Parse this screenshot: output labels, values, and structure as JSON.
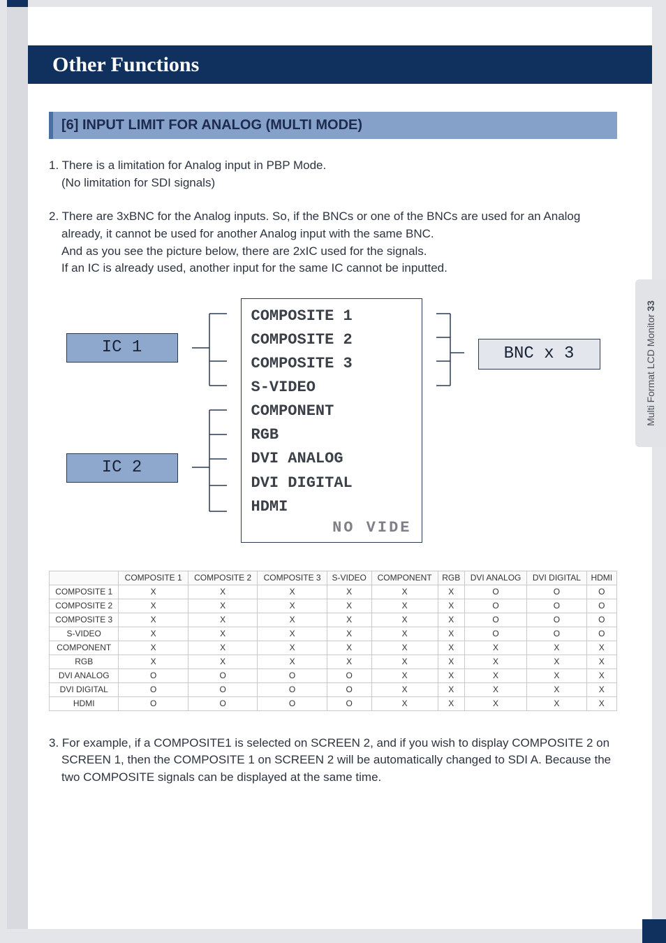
{
  "header": {
    "title": "Other Functions"
  },
  "section": {
    "title": "[6] INPUT LIMIT FOR ANALOG (MULTI MODE)"
  },
  "para1_lead": "1. There is a limitation for Analog input in PBP Mode.",
  "para1_sub": "(No limitation for SDI signals)",
  "para2_lead": "2. There are 3xBNC for the Analog inputs. So, if the BNCs or one of the BNCs are used for an Analog",
  "para2_l2": "already, it cannot be used for another Analog input with the same BNC.",
  "para2_l3": "And as you see the picture below, there are 2xIC used for the signals.",
  "para2_l4": "If an IC is already used, another input for the same IC cannot be inputted.",
  "diagram": {
    "ic1": "IC 1",
    "ic2": "IC 2",
    "bnc": "BNC x 3",
    "signals": [
      "COMPOSITE 1",
      "COMPOSITE 2",
      "COMPOSITE 3",
      "S-VIDEO",
      "COMPONENT",
      "RGB",
      "DVI ANALOG",
      "DVI DIGITAL",
      "HDMI"
    ],
    "footer": "NO  VIDE"
  },
  "table": {
    "cols": [
      "COMPOSITE 1",
      "COMPOSITE 2",
      "COMPOSITE 3",
      "S-VIDEO",
      "COMPONENT",
      "RGB",
      "DVI ANALOG",
      "DVI DIGITAL",
      "HDMI"
    ],
    "rows": [
      {
        "name": "COMPOSITE 1",
        "v": [
          "X",
          "X",
          "X",
          "X",
          "X",
          "X",
          "O",
          "O",
          "O"
        ]
      },
      {
        "name": "COMPOSITE 2",
        "v": [
          "X",
          "X",
          "X",
          "X",
          "X",
          "X",
          "O",
          "O",
          "O"
        ]
      },
      {
        "name": "COMPOSITE 3",
        "v": [
          "X",
          "X",
          "X",
          "X",
          "X",
          "X",
          "O",
          "O",
          "O"
        ]
      },
      {
        "name": "S-VIDEO",
        "v": [
          "X",
          "X",
          "X",
          "X",
          "X",
          "X",
          "O",
          "O",
          "O"
        ]
      },
      {
        "name": "COMPONENT",
        "v": [
          "X",
          "X",
          "X",
          "X",
          "X",
          "X",
          "X",
          "X",
          "X"
        ]
      },
      {
        "name": "RGB",
        "v": [
          "X",
          "X",
          "X",
          "X",
          "X",
          "X",
          "X",
          "X",
          "X"
        ]
      },
      {
        "name": "DVI ANALOG",
        "v": [
          "O",
          "O",
          "O",
          "O",
          "X",
          "X",
          "X",
          "X",
          "X"
        ]
      },
      {
        "name": "DVI DIGITAL",
        "v": [
          "O",
          "O",
          "O",
          "O",
          "X",
          "X",
          "X",
          "X",
          "X"
        ]
      },
      {
        "name": "HDMI",
        "v": [
          "O",
          "O",
          "O",
          "O",
          "X",
          "X",
          "X",
          "X",
          "X"
        ]
      }
    ]
  },
  "para3_lead": "3. For example, if a COMPOSITE1 is selected on SCREEN 2, and if you wish to display COMPOSITE 2 on",
  "para3_l2": "SCREEN 1, then the COMPOSITE 1 on SCREEN 2 will be automatically changed to SDI A. Because the",
  "para3_l3": "two COMPOSITE signals can be displayed at the same time.",
  "sidetab": {
    "label": "Multi Format LCD Monitor ",
    "page": "33"
  }
}
